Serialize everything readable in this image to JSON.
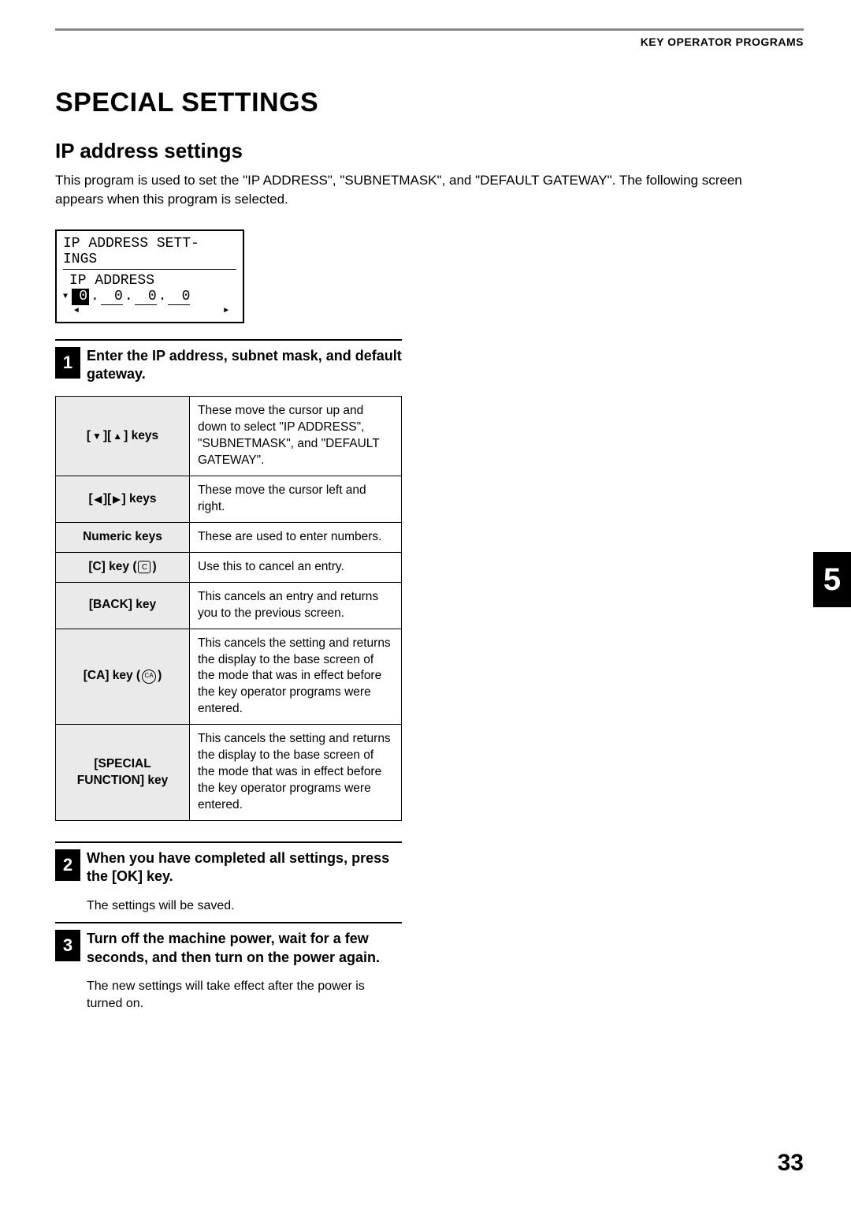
{
  "header": {
    "running_head": "KEY OPERATOR PROGRAMS"
  },
  "section_title": "SPECIAL SETTINGS",
  "sub_title": "IP address settings",
  "intro": "This program is used to set the \"IP ADDRESS\", \"SUBNETMASK\", and \"DEFAULT GATEWAY\". The following screen appears when this program is selected.",
  "lcd": {
    "line1": "IP ADDRESS SETT-",
    "line1b": "INGS",
    "line2": "IP ADDRESS",
    "seg1": "0",
    "seg2": "0",
    "seg3": "0",
    "seg4": "0"
  },
  "steps": [
    {
      "num": "1",
      "title": "Enter the IP address, subnet mask, and default gateway.",
      "note": ""
    },
    {
      "num": "2",
      "title": "When you have completed all settings, press the [OK] key.",
      "note": "The settings will be saved."
    },
    {
      "num": "3",
      "title": "Turn off the machine power, wait for a few seconds, and then turn on the power again.",
      "note": "The new settings will take effect after the power is turned on."
    }
  ],
  "keys_table": [
    {
      "key_prefix": "[",
      "key_icons": "vu",
      "key_suffix": "] keys",
      "desc": "These move the cursor up and down to select \"IP ADDRESS\", \"SUBNETMASK\", and \"DEFAULT GATEWAY\"."
    },
    {
      "key_prefix": "[",
      "key_icons": "lr",
      "key_suffix": "] keys",
      "desc": "These move the cursor left and right."
    },
    {
      "key_label": "Numeric keys",
      "desc": "These are used to enter numbers."
    },
    {
      "key_label_c": "[C] key (",
      "key_label_c_suffix": ")",
      "desc": "Use this to cancel an entry."
    },
    {
      "key_label": "[BACK] key",
      "desc": "This cancels an entry and returns you to the previous screen."
    },
    {
      "key_label_ca": "[CA] key (",
      "key_label_ca_suffix": ")",
      "desc": "This cancels the setting and returns the display to the base screen of the mode that was in effect before the key operator programs were entered."
    },
    {
      "key_label": "[SPECIAL FUNCTION] key",
      "desc": "This cancels the setting and returns the display to the base screen of the mode that was in effect before the key operator programs were entered."
    }
  ],
  "chapter_tab": "5",
  "page_number": "33"
}
